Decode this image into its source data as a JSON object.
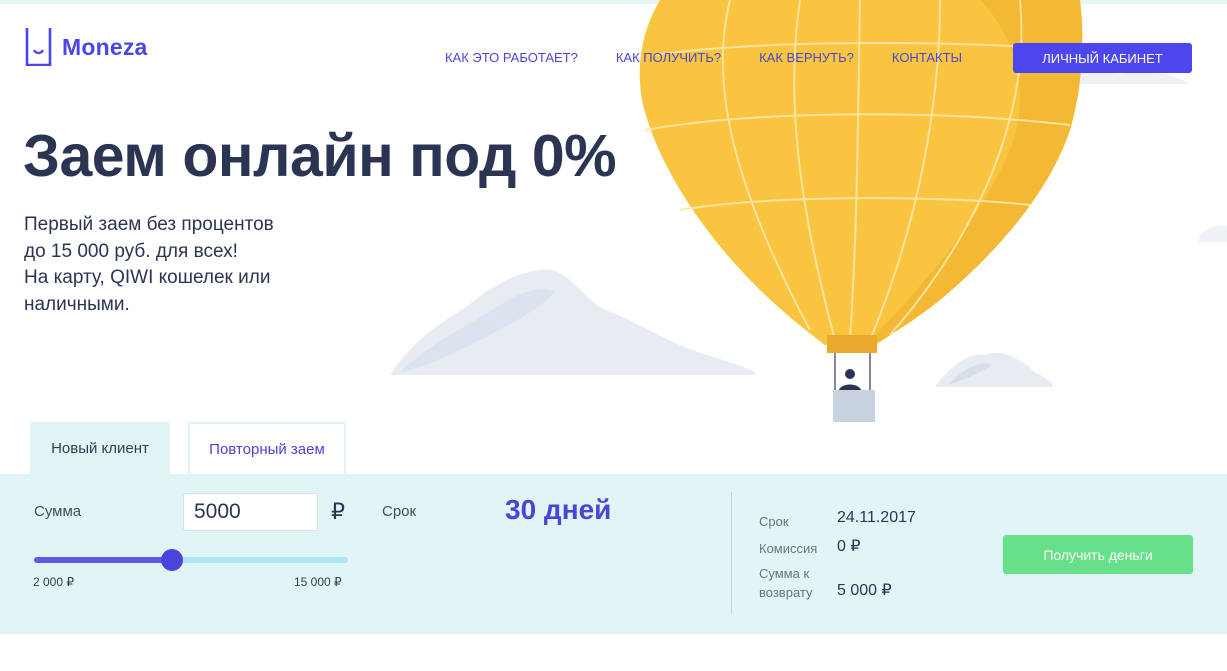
{
  "logo": {
    "text": "Moneza"
  },
  "nav": {
    "items": [
      "КАК ЭТО РАБОТАЕТ?",
      "КАК ПОЛУЧИТЬ?",
      "КАК ВЕРНУТЬ?",
      "КОНТАКТЫ"
    ],
    "cabinet_label": "ЛИЧНЫЙ КАБИНЕТ"
  },
  "hero": {
    "title": "Заем онлайн под 0%",
    "subtitle_lines": [
      "Первый заем без процентов",
      "до 15 000 руб. для всех!",
      "На карту, QIWI кошелек или",
      "наличными."
    ]
  },
  "tabs": {
    "new_client": "Новый клиент",
    "repeat_loan": "Повторный заем"
  },
  "calculator": {
    "sum_label": "Сумма",
    "sum_value": "5000",
    "currency_symbol": "₽",
    "slider": {
      "min_label": "2 000 ₽",
      "max_label": "15 000 ₽",
      "min": 2000,
      "max": 15000,
      "value": 5000
    },
    "term_label": "Срок",
    "term_value": "30 дней",
    "summary": {
      "date_label": "Срок",
      "date_value": "24.11.2017",
      "fee_label": "Комиссия",
      "fee_value": "0 ₽",
      "return_label_line1": "Сумма к",
      "return_label_line2": "возврату",
      "return_value": "5 000 ₽"
    },
    "submit_label": "Получить деньги"
  },
  "colors": {
    "brand": "#4d46ec",
    "heading": "#2b3553",
    "panel_bg": "#e2f5f6",
    "cta_green": "#67e08a",
    "balloon": "#f9c540"
  },
  "icons": {
    "logo_mark": "cup-smile-icon",
    "balloon": "hot-air-balloon-illustration"
  }
}
